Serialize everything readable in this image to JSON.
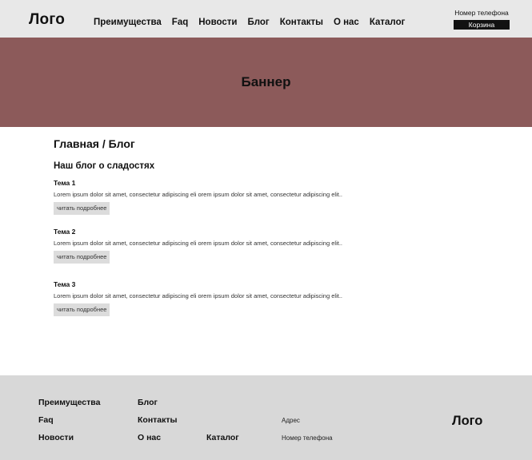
{
  "header": {
    "logo": "Лого",
    "nav": [
      "Преимущества",
      "Faq",
      "Новости",
      "Блог",
      "Контакты",
      "О нас",
      "Каталог"
    ],
    "phone": "Номер телефона",
    "cart_label": "Корзина"
  },
  "banner": {
    "title": "Баннер"
  },
  "breadcrumb": {
    "home": "Главная",
    "separator": " / ",
    "current": "Блог"
  },
  "page_title": "Наш блог о сладостях",
  "posts": [
    {
      "title": "Тема 1",
      "excerpt": "Lorem ipsum dolor sit amet, consectetur adipiscing eli orem ipsum dolor sit amet, consectetur adipiscing elit..",
      "read_more": "читать подробнее"
    },
    {
      "title": "Тема 2",
      "excerpt": "Lorem ipsum dolor sit amet, consectetur adipiscing eli orem ipsum dolor sit amet, consectetur adipiscing elit..",
      "read_more": "читать подробнее"
    },
    {
      "title": "Тема 3",
      "excerpt": "Lorem ipsum dolor sit amet, consectetur adipiscing eli orem ipsum dolor sit amet, consectetur adipiscing elit..",
      "read_more": "читать подробнее"
    }
  ],
  "footer": {
    "links": {
      "advantages": "Преимущества",
      "faq": "Faq",
      "news": "Новости",
      "blog": "Блог",
      "contacts": "Контакты",
      "about": "О нас",
      "catalog": "Каталог"
    },
    "address": "Адрес",
    "phone": "Номер телефона",
    "logo": "Лого"
  },
  "colors": {
    "header_bg": "#e8e8e8",
    "banner_bg": "#8c5a5a",
    "footer_bg": "#d8d8d8",
    "button_bg": "#dcdcdc",
    "cart_bg": "#111111"
  }
}
